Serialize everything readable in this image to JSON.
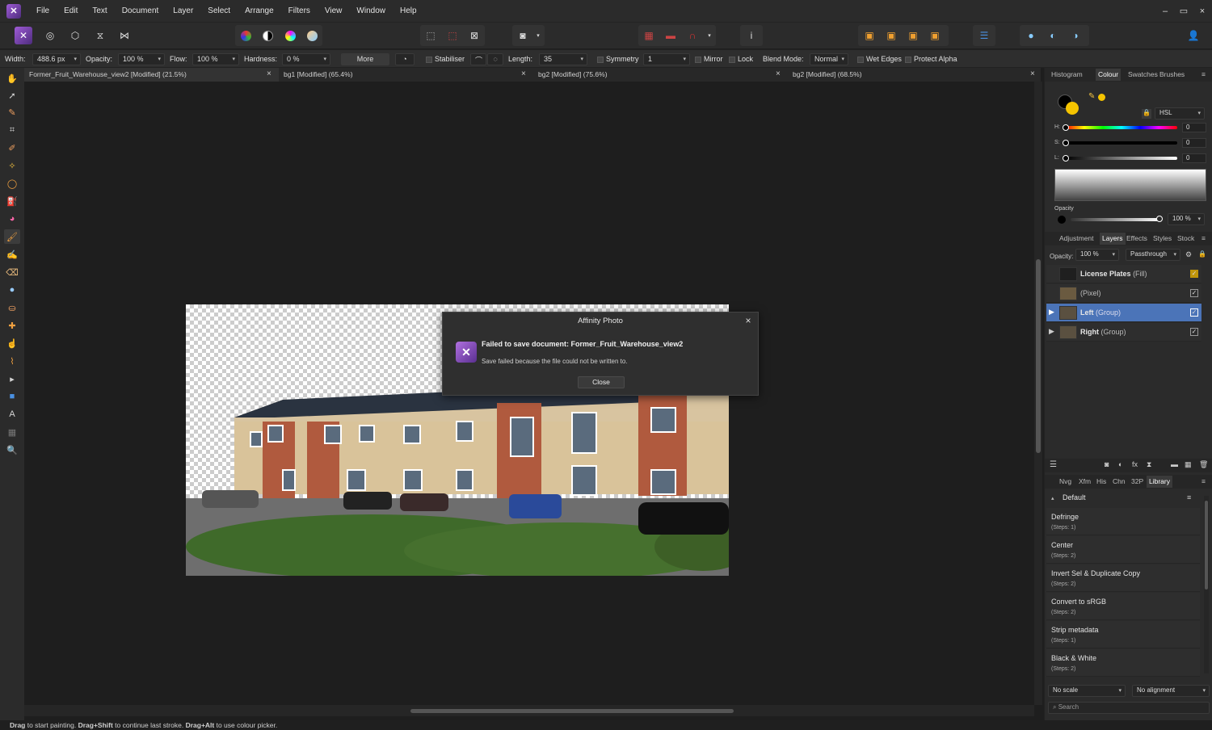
{
  "menubar": {
    "items": [
      "File",
      "Edit",
      "Text",
      "Document",
      "Layer",
      "Select",
      "Arrange",
      "Filters",
      "View",
      "Window",
      "Help"
    ],
    "window_controls": [
      "–",
      "▭",
      "×"
    ]
  },
  "context": {
    "width_label": "Width:",
    "width_value": "488.6 px",
    "opacity_label": "Opacity:",
    "opacity_value": "100 %",
    "flow_label": "Flow:",
    "flow_value": "100 %",
    "hardness_label": "Hardness:",
    "hardness_value": "0 %",
    "more_label": "More",
    "stabiliser_label": "Stabiliser",
    "length_label": "Length:",
    "length_value": "35",
    "symmetry_label": "Symmetry",
    "symmetry_value": "1",
    "mirror_label": "Mirror",
    "lock_label": "Lock",
    "blend_label": "Blend Mode:",
    "blend_value": "Normal",
    "wet_edges_label": "Wet Edges",
    "protect_alpha_label": "Protect Alpha"
  },
  "tabs": [
    {
      "label": "Former_Fruit_Warehouse_view2 [Modified] (21.5%)"
    },
    {
      "label": "bg1 [Modified] (65.4%)"
    },
    {
      "label": "bg2 [Modified] (75.6%)"
    },
    {
      "label": "bg2 [Modified] (68.5%)"
    }
  ],
  "dialog": {
    "title": "Affinity Photo",
    "heading": "Failed to save document: Former_Fruit_Warehouse_view2",
    "message": "Save failed because the file could not be written to.",
    "close_label": "Close"
  },
  "status": {
    "k1": "Drag",
    "t1": " to start painting. ",
    "k2": "Drag+Shift",
    "t2": " to continue last stroke. ",
    "k3": "Drag+Alt",
    "t3": " to use colour picker."
  },
  "colour_panel": {
    "tabs": [
      "Histogram",
      "Colour",
      "Swatches",
      "Brushes"
    ],
    "active_tab": "Colour",
    "model": "HSL",
    "h_label": "H:",
    "h_value": "0",
    "s_label": "S:",
    "s_value": "0",
    "l_label": "L:",
    "l_value": "0",
    "opacity_label": "Opacity",
    "opacity_value": "100 %",
    "primary_color": "#000000",
    "secondary_color": "#f5c400"
  },
  "layers_panel": {
    "tabs": [
      "Adjustment",
      "Layers",
      "Effects",
      "Styles",
      "Stock"
    ],
    "active_tab": "Layers",
    "opacity_label": "Opacity:",
    "opacity_value": "100 %",
    "blend_value": "Passthrough",
    "layers": [
      {
        "name": "License Plates",
        "type": "(Fill)"
      },
      {
        "name": "",
        "type": "(Pixel)"
      },
      {
        "name": "Left",
        "type": "(Group)"
      },
      {
        "name": "Right",
        "type": "(Group)"
      }
    ]
  },
  "library_panel": {
    "tabs": [
      "Nvg",
      "Xfm",
      "His",
      "Chn",
      "32P",
      "Library"
    ],
    "active_tab": "Library",
    "category": "Default",
    "macros": [
      {
        "name": "Defringe",
        "steps": "(Steps: 1)"
      },
      {
        "name": "Center",
        "steps": "(Steps: 2)"
      },
      {
        "name": "Invert Sel & Duplicate Copy",
        "steps": "(Steps: 2)"
      },
      {
        "name": "Convert to sRGB",
        "steps": "(Steps: 2)"
      },
      {
        "name": "Strip metadata",
        "steps": "(Steps: 1)"
      },
      {
        "name": "Black & White",
        "steps": "(Steps: 2)"
      }
    ],
    "scale_value": "No scale",
    "alignment_value": "No alignment",
    "search_placeholder": "Search"
  }
}
